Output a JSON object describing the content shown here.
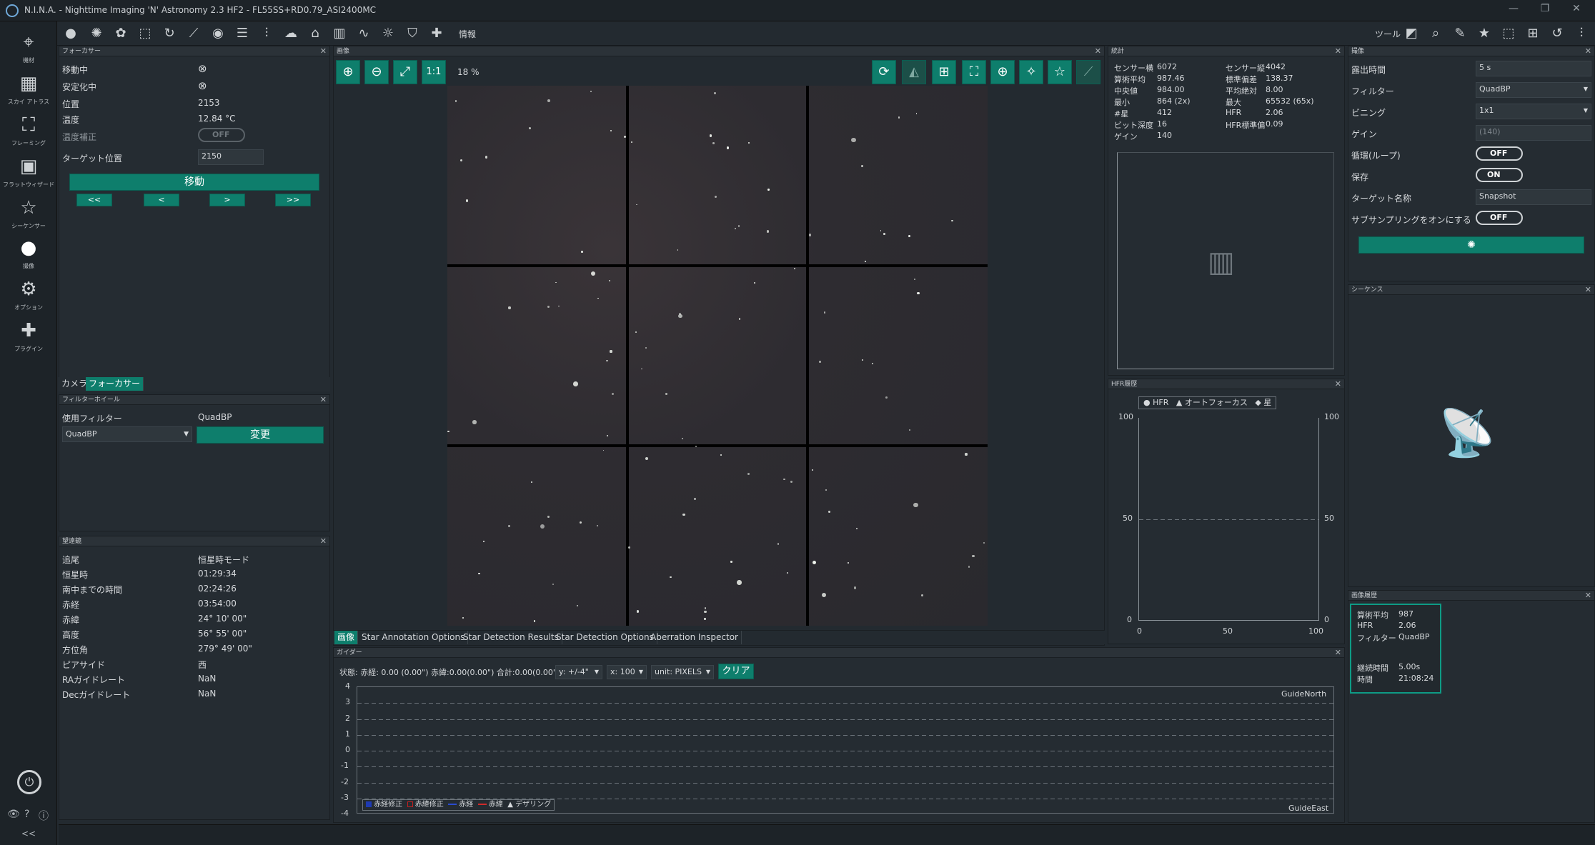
{
  "titlebar": {
    "title": "N.I.N.A. - Nighttime Imaging 'N' Astronomy 2.3 HF2   -  FL55SS+RD0.79_ASI2400MC"
  },
  "nav": [
    {
      "label": "機材",
      "icon": "telescope-icon"
    },
    {
      "label": "スカイ アトラス",
      "icon": "sky-atlas-icon"
    },
    {
      "label": "フレーミング",
      "icon": "framing-icon"
    },
    {
      "label": "フラットウィザード",
      "icon": "flat-wizard-icon"
    },
    {
      "label": "シーケンサー",
      "icon": "sequencer-icon"
    },
    {
      "label": "撮像",
      "icon": "imaging-icon"
    },
    {
      "label": "オプション",
      "icon": "options-icon"
    },
    {
      "label": "プラグイン",
      "icon": "plugins-icon"
    }
  ],
  "toolbar": {
    "info_label": "情報",
    "tools_label": "ツール"
  },
  "focuser": {
    "title": "フォーカサー",
    "rows": [
      {
        "label": "移動中",
        "value": "⊗"
      },
      {
        "label": "安定化中",
        "value": "⊗"
      },
      {
        "label": "位置",
        "value": "2153"
      },
      {
        "label": "温度",
        "value": "12.84 °C"
      },
      {
        "label": "温度補正",
        "value": "OFF"
      }
    ],
    "target_label": "ターゲット位置",
    "target_value": "2150",
    "move_label": "移動",
    "steps": [
      "<<",
      "<",
      ">",
      ">>"
    ]
  },
  "left_tabs": [
    "カメラ",
    "フォーカサー"
  ],
  "filterwheel": {
    "title": "フィルターホイール",
    "current_label": "使用フィルター",
    "current_value": "QuadBP",
    "select_value": "QuadBP",
    "change_label": "変更"
  },
  "telescope": {
    "title": "望遠鏡",
    "rows": [
      {
        "label": "追尾",
        "value": "恒星時モード"
      },
      {
        "label": "恒星時",
        "value": "01:29:34"
      },
      {
        "label": "南中までの時間",
        "value": "02:24:26"
      },
      {
        "label": "赤経",
        "value": "03:54:00"
      },
      {
        "label": "赤緯",
        "value": "24° 10' 00\""
      },
      {
        "label": "高度",
        "value": "56° 55' 00\""
      },
      {
        "label": "方位角",
        "value": "279° 49' 00\""
      },
      {
        "label": "ピアサイド",
        "value": "西"
      },
      {
        "label": "RAガイドレート",
        "value": "NaN"
      },
      {
        "label": "Decガイドレート",
        "value": "NaN"
      }
    ]
  },
  "image_panel": {
    "title": "画像",
    "zoom_one": "1:1",
    "zoom_pct": "18 %",
    "tabs": [
      "画像",
      "Star Annotation Options",
      "Star Detection Results",
      "Star Detection Options",
      "Aberration Inspector"
    ]
  },
  "stats": {
    "title": "統計",
    "left": [
      {
        "label": "センサー横",
        "value": "6072"
      },
      {
        "label": "算術平均",
        "value": "987.46"
      },
      {
        "label": "中央値",
        "value": "984.00"
      },
      {
        "label": "最小",
        "value": "864 (2x)"
      },
      {
        "label": "#星",
        "value": "412"
      },
      {
        "label": "ビット深度",
        "value": "16"
      },
      {
        "label": "ゲイン",
        "value": "140"
      }
    ],
    "right": [
      {
        "label": "センサー縦",
        "value": "4042"
      },
      {
        "label": "標準偏差",
        "value": "138.37"
      },
      {
        "label": "平均絶対",
        "value": "8.00"
      },
      {
        "label": "最大",
        "value": "65532 (65x)"
      },
      {
        "label": "HFR",
        "value": "2.06"
      },
      {
        "label": "HFR標準偏",
        "value": "0.09"
      }
    ]
  },
  "hfr_history": {
    "title": "HFR履歴",
    "legend": [
      "HFR",
      "オートフォーカス",
      "星"
    ],
    "y_ticks": [
      "100",
      "50",
      "0"
    ],
    "x_ticks": [
      "0",
      "50",
      "100"
    ]
  },
  "guider": {
    "title": "ガイダー",
    "status": "状態:  赤経: 0.00 (0.00\")  赤緯:0.00(0.00\")  合計:0.00(0.00\")",
    "y_select": "y: +/-4\"",
    "x_select": "x: 100",
    "unit_select": "unit: PIXELS",
    "clear_label": "クリア",
    "y_ticks": [
      "4",
      "3",
      "2",
      "1",
      "0",
      "-1",
      "-2",
      "-3",
      "-4"
    ],
    "north_label": "GuideNorth",
    "east_label": "GuideEast",
    "legend": [
      "赤経修正",
      "赤緯修正",
      "赤経",
      "赤緯",
      "デザリング"
    ]
  },
  "capture": {
    "title": "撮像",
    "rows": [
      {
        "label": "露出時間",
        "value": "5  s"
      },
      {
        "label": "フィルター",
        "value": "QuadBP"
      },
      {
        "label": "ビニング",
        "value": "1x1"
      },
      {
        "label": "ゲイン",
        "value": "(140)"
      },
      {
        "label": "循環(ループ)",
        "value": "OFF"
      },
      {
        "label": "保存",
        "value": "ON"
      },
      {
        "label": "ターゲット名称",
        "value": "Snapshot"
      },
      {
        "label": "サブサンプリングをオンにする",
        "value": "OFF"
      }
    ]
  },
  "sequence": {
    "title": "シーケンス"
  },
  "image_history": {
    "title": "画像履歴",
    "rows": [
      {
        "label": "算術平均",
        "value": "987"
      },
      {
        "label": "HFR",
        "value": "2.06"
      },
      {
        "label": "フィルター",
        "value": "QuadBP"
      },
      {
        "label": "継続時間",
        "value": "5.00s"
      },
      {
        "label": "時間",
        "value": "21:08:24"
      }
    ]
  },
  "colors": {
    "accent": "#0e7e6c",
    "background": "#232a30",
    "panel": "#252c32"
  }
}
